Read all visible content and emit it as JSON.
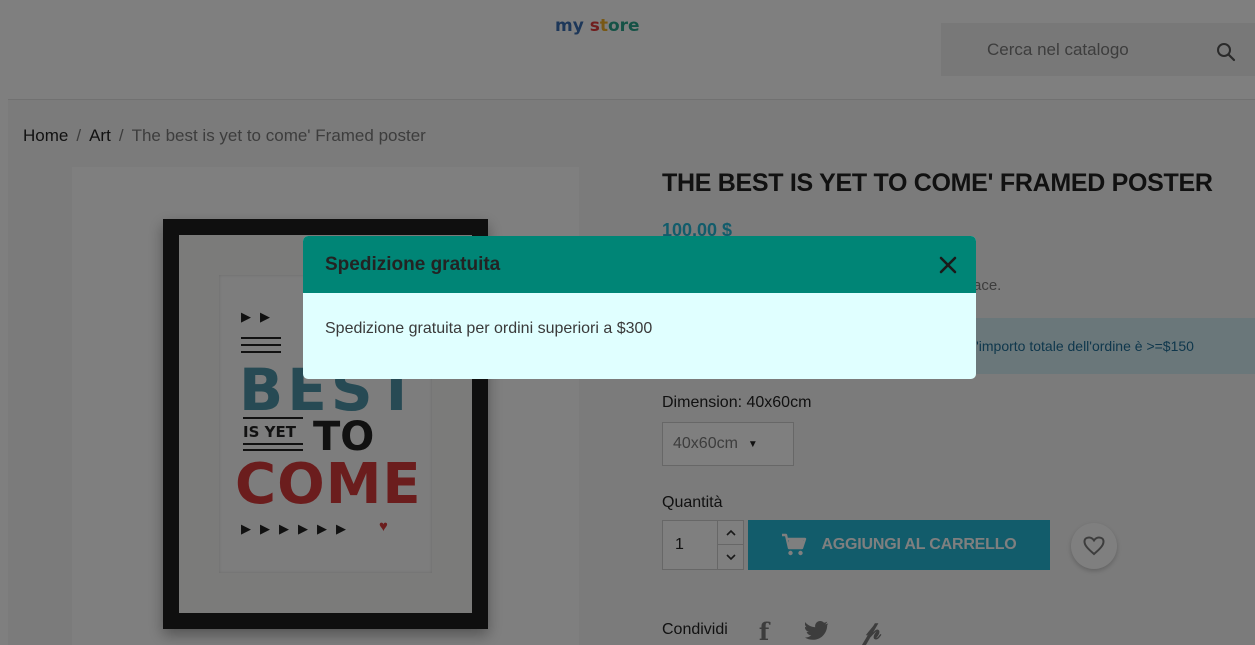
{
  "header": {
    "logo": {
      "part1": "my",
      "part2": "s",
      "part3": "t",
      "part4": "ore"
    },
    "search": {
      "placeholder": "Cerca nel catalogo"
    }
  },
  "breadcrumb": {
    "items": [
      "Home",
      "Art",
      "The best is yet to come' Framed poster"
    ],
    "separator": "/"
  },
  "product": {
    "title": "THE BEST IS YET TO COME' FRAMED POSTER",
    "price": "100,00 $",
    "description_tail": "ace.",
    "promo_text": "l'importo totale dell'ordine è >=$150",
    "variant": {
      "label": "Dimension: 40x60cm",
      "selected": "40x60cm"
    },
    "quantity": {
      "label": "Quantità",
      "value": "1"
    },
    "add_to_cart_label": "AGGIUNGI AL CARRELLO",
    "share_label": "Condividi"
  },
  "poster": {
    "best": "BEST",
    "is_yet": "IS YET",
    "to": "TO",
    "come": "COME"
  },
  "modal": {
    "title": "Spedizione gratuita",
    "body": "Spedizione gratuita per ordini superiori a $300"
  },
  "colors": {
    "modal_header": "#008576",
    "modal_body": "#e0ffff",
    "accent": "#24b9d7",
    "overlay": "rgba(0,0,0,0.5)"
  },
  "icons": {
    "search": "search-icon",
    "close": "close-icon",
    "cart": "shopping-cart-icon",
    "wishlist": "heart-icon",
    "facebook": "facebook-icon",
    "twitter": "twitter-icon",
    "pinterest": "pinterest-icon"
  }
}
